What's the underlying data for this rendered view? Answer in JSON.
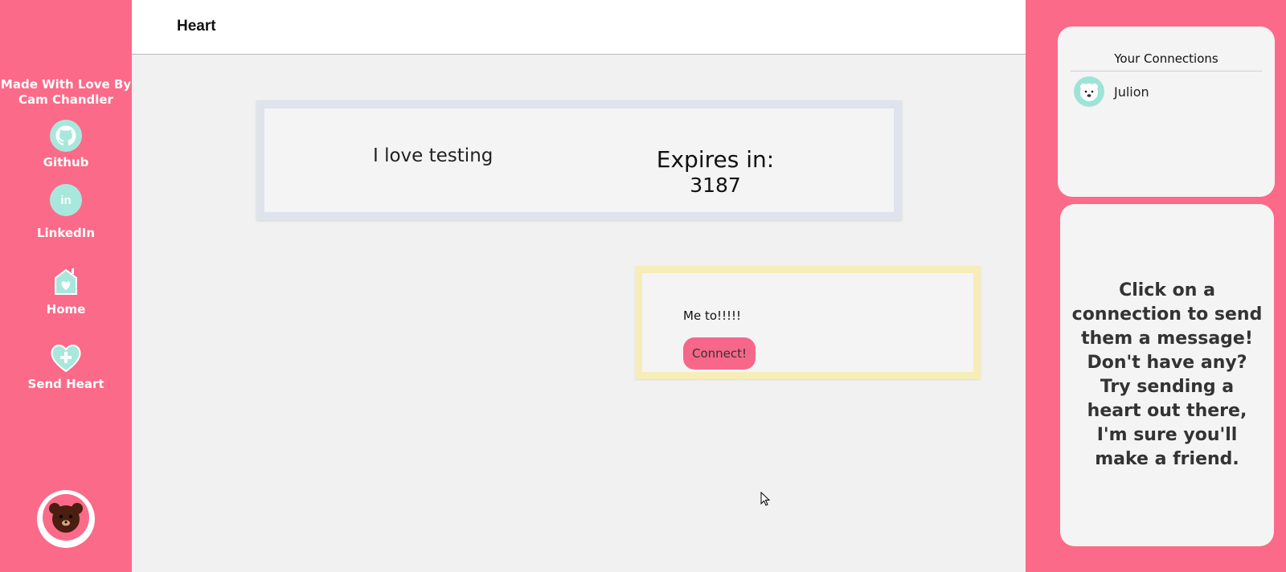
{
  "sidebar": {
    "credit": "Made With Love By Cam Chandler",
    "links": [
      {
        "label": "Github",
        "icon": "github-icon"
      },
      {
        "label": "LinkedIn",
        "icon": "linkedin-icon"
      },
      {
        "label": "Home",
        "icon": "home-icon"
      },
      {
        "label": "Send Heart",
        "icon": "heart-plus-icon"
      }
    ],
    "avatar_icon": "bear-avatar-icon"
  },
  "header": {
    "title": "Heart"
  },
  "heart_card": {
    "message": "I love testing",
    "expires_label": "Expires in:",
    "expires_value": "3187"
  },
  "reply_card": {
    "message": "Me to!!!!!",
    "button_label": "Connect!"
  },
  "connections": {
    "title": "Your Connections",
    "items": [
      {
        "name": "Julion",
        "icon": "polar-bear-avatar-icon"
      }
    ]
  },
  "message_panel": {
    "text": "Click on a connection to send them a message! Don't have any? Try sending a heart out there, I'm sure you'll make a friend."
  },
  "colors": {
    "primary_pink": "#fb6a88",
    "mint": "#a8e8dc",
    "blue_card": "#dee3ec",
    "yellow_card": "#f6edb8",
    "button_pink": "#f7678a"
  }
}
